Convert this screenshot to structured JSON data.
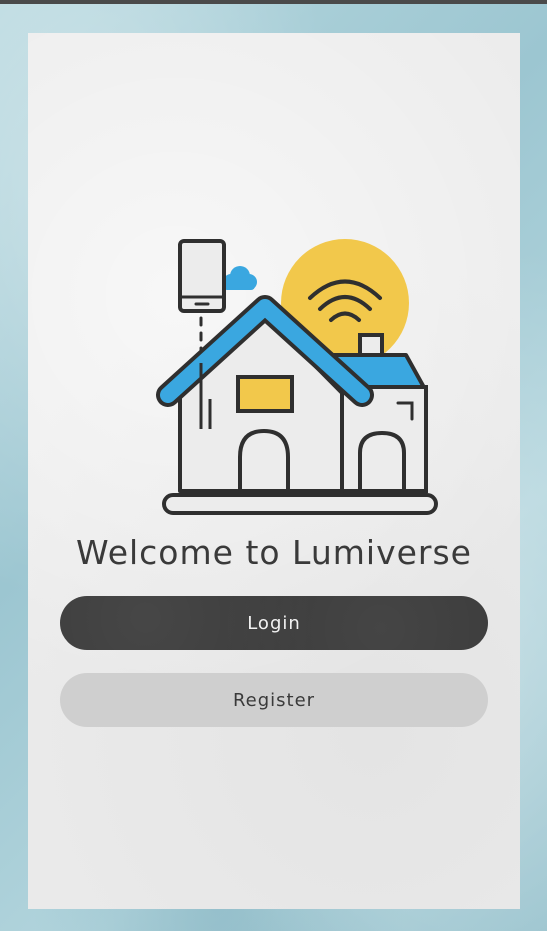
{
  "welcome": {
    "title": "Welcome to Lumiverse"
  },
  "actions": {
    "login_label": "Login",
    "register_label": "Register"
  },
  "illustration": {
    "name": "smart-home-icon"
  },
  "colors": {
    "background": "#a9cdd6",
    "card": "#ececec",
    "login_button": "#3b3b3b",
    "register_button": "#cfcfcf",
    "accent_blue": "#3aa7e0",
    "accent_yellow": "#f2c84b",
    "line": "#2f2f2f"
  }
}
